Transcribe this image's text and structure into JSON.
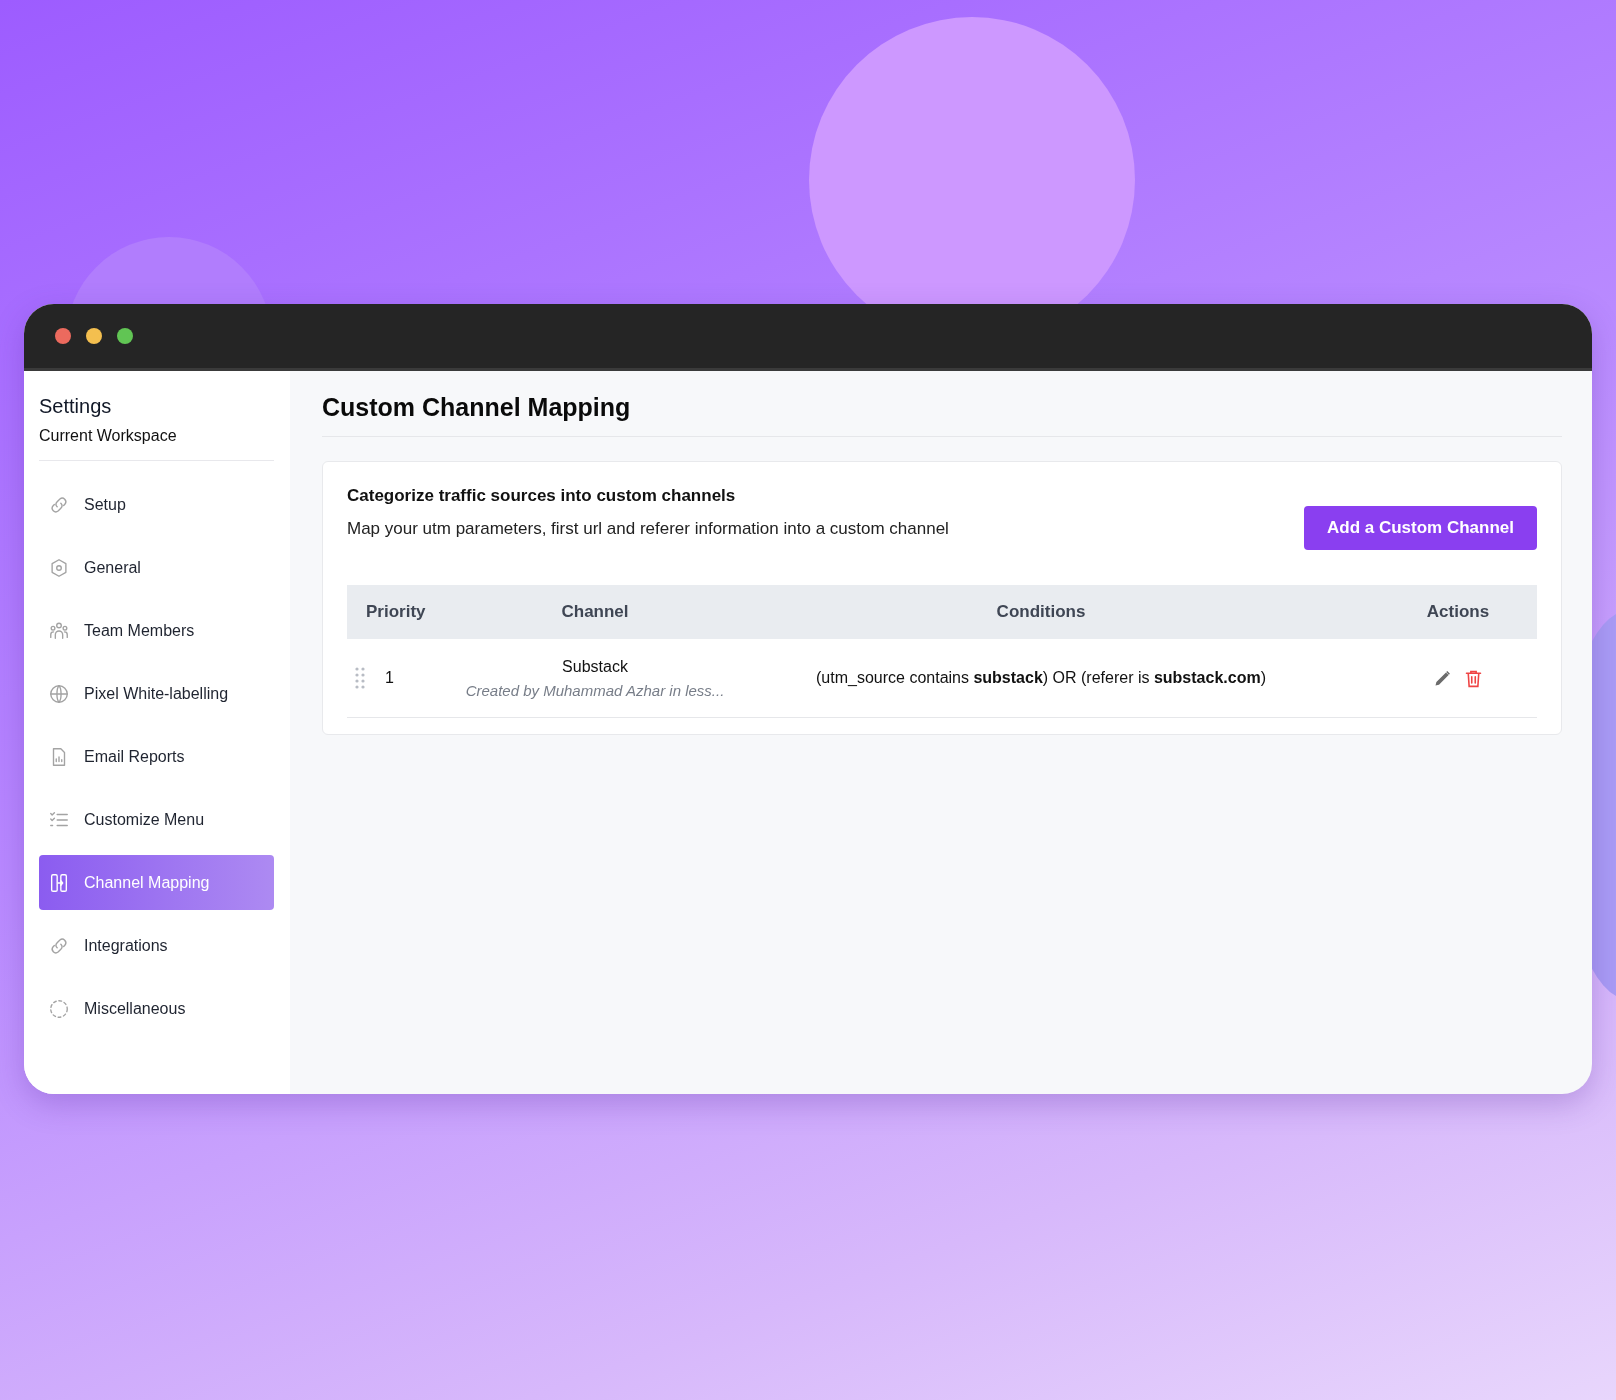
{
  "sidebar": {
    "title": "Settings",
    "subtitle": "Current Workspace",
    "items": [
      {
        "label": "Setup",
        "selected": false
      },
      {
        "label": "General",
        "selected": false
      },
      {
        "label": "Team Members",
        "selected": false
      },
      {
        "label": "Pixel White-labelling",
        "selected": false
      },
      {
        "label": "Email Reports",
        "selected": false
      },
      {
        "label": "Customize Menu",
        "selected": false
      },
      {
        "label": "Channel Mapping",
        "selected": true
      },
      {
        "label": "Integrations",
        "selected": false
      },
      {
        "label": "Miscellaneous",
        "selected": false
      }
    ]
  },
  "page": {
    "title": "Custom Channel Mapping"
  },
  "card": {
    "heading": "Categorize traffic sources into custom channels",
    "description": "Map your utm parameters, first url and referer information into a custom channel",
    "add_button": "Add a Custom Channel"
  },
  "table": {
    "columns": [
      "Priority",
      "Channel",
      "Conditions",
      "Actions"
    ],
    "rows": [
      {
        "priority": "1",
        "channel": "Substack",
        "created": "Created by Muhammad Azhar in less...",
        "conditions": "(utm_source contains **substack**) OR (referer is **substack.com**)"
      }
    ]
  }
}
